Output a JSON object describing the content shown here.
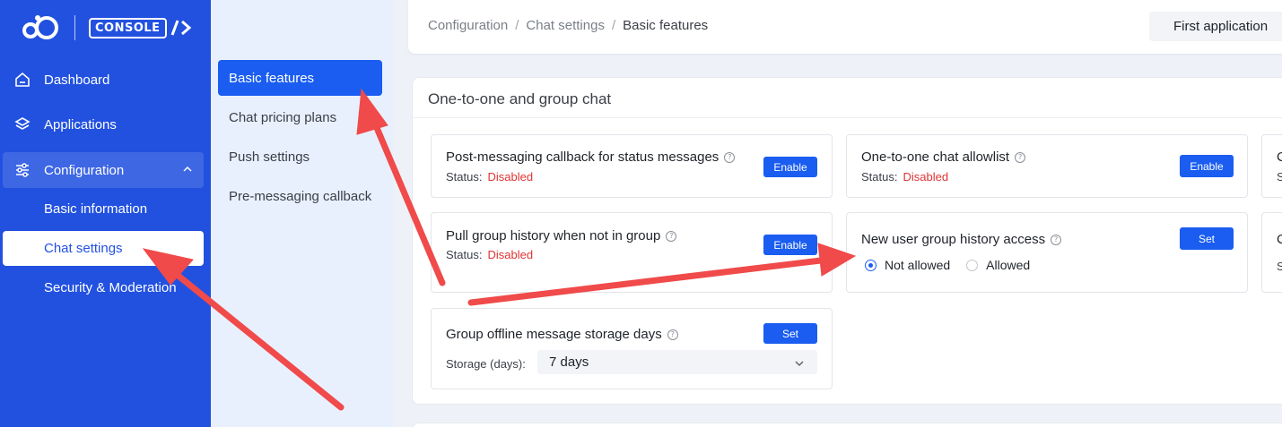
{
  "sidebar": {
    "console_label": "CONSOLE",
    "items": [
      {
        "label": "Dashboard"
      },
      {
        "label": "Applications"
      },
      {
        "label": "Configuration"
      }
    ],
    "subitems": [
      {
        "label": "Basic information"
      },
      {
        "label": "Chat settings"
      },
      {
        "label": "Security & Moderation"
      }
    ]
  },
  "submenu": {
    "items": [
      {
        "label": "Basic features"
      },
      {
        "label": "Chat pricing plans"
      },
      {
        "label": "Push settings"
      },
      {
        "label": "Pre-messaging callback"
      }
    ]
  },
  "header": {
    "breadcrumb": [
      "Configuration",
      "Chat settings",
      "Basic features"
    ],
    "app_selector": "First application"
  },
  "section": {
    "title": "One-to-one and group chat",
    "status_label": "Status:",
    "features": {
      "post_callback": {
        "title": "Post-messaging callback for status messages",
        "status": "Disabled",
        "button": "Enable"
      },
      "allowlist": {
        "title": "One-to-one chat allowlist",
        "status": "Disabled",
        "button": "Enable"
      },
      "pull_history": {
        "title": "Pull group history when not in group",
        "status": "Disabled",
        "button": "Enable"
      },
      "new_user_history": {
        "title": "New user group history access",
        "button": "Set",
        "options": [
          "Not allowed",
          "Allowed"
        ],
        "selected": "Not allowed"
      },
      "offline_storage": {
        "title": "Group offline message storage days",
        "button": "Set",
        "storage_label": "Storage (days):",
        "storage_value": "7 days"
      }
    },
    "partial_cards": [
      "C",
      "S"
    ]
  },
  "colors": {
    "sidebar": "#2251e0",
    "primary": "#1a5df0",
    "danger": "#e03434",
    "annotation": "#f04a4a"
  }
}
